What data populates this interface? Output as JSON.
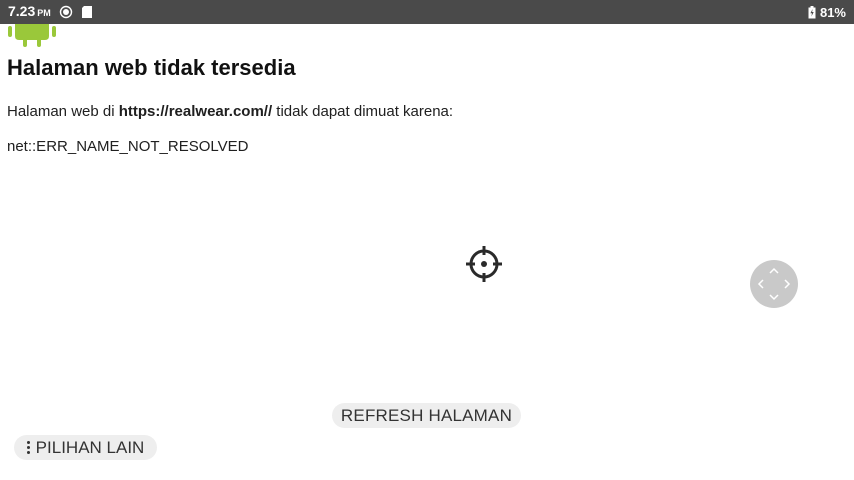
{
  "status_bar": {
    "time": "7.23",
    "ampm": "PM",
    "battery_percent": "81%",
    "icons": [
      "sync-icon",
      "sd-card-icon",
      "battery-icon"
    ]
  },
  "error_page": {
    "icon": "android-robot-icon",
    "title": "Halaman web tidak tersedia",
    "message_prefix": "Halaman web di ",
    "url": "https://realwear.com//",
    "message_suffix": " tidak dapat dimuat karena:",
    "error_code": "net::ERR_NAME_NOT_RESOLVED"
  },
  "overlay": {
    "crosshair_icon": "crosshair-icon",
    "nav_pad_icon": "directional-pad-icon"
  },
  "buttons": {
    "refresh_label": "REFRESH HALAMAN",
    "more_options_label": "PILIHAN LAIN"
  },
  "colors": {
    "status_bar_bg": "#4a4a4a",
    "android_green": "#9ac83a",
    "button_bg": "#eeeeee"
  }
}
